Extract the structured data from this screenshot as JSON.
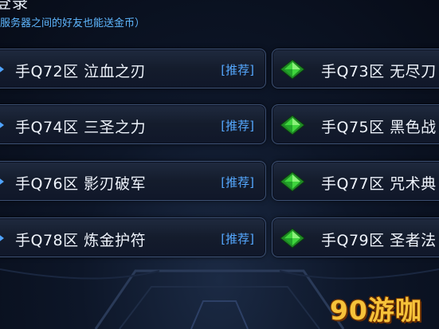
{
  "header": {
    "title": "登录",
    "subtitle": "服务器之间的好友也能送金币）"
  },
  "servers_left": [
    {
      "label": "手Q72区 泣血之刃",
      "tag": "[推荐]"
    },
    {
      "label": "手Q74区 三圣之力",
      "tag": "[推荐]"
    },
    {
      "label": "手Q76区 影刃破军",
      "tag": "[推荐]"
    },
    {
      "label": "手Q78区 炼金护符",
      "tag": "[推荐]"
    }
  ],
  "servers_right": [
    {
      "label": "手Q73区 无尽刀"
    },
    {
      "label": "手Q75区 黑色战"
    },
    {
      "label": "手Q77区 咒术典"
    },
    {
      "label": "手Q79区 圣者法"
    }
  ],
  "watermark": "90游咖",
  "icons": {
    "left": "arrow-right-icon",
    "right": "green-gem-icon"
  },
  "colors": {
    "accent": "#4fa3ff",
    "gem": "#39d13a",
    "watermark": "#f6c23a"
  }
}
